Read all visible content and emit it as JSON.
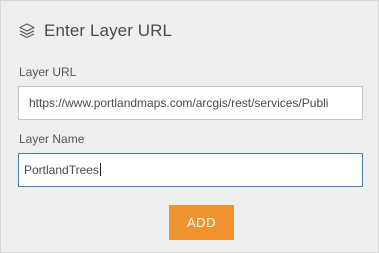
{
  "dialog": {
    "title": "Enter Layer URL",
    "title_icon": "layers-icon"
  },
  "layer_url": {
    "label": "Layer URL",
    "value": "https://www.portlandmaps.com/arcgis/rest/services/Publi"
  },
  "layer_name": {
    "label": "Layer Name",
    "value": "PortlandTrees"
  },
  "actions": {
    "add_label": "ADD"
  },
  "colors": {
    "panel_background": "#efefef",
    "accent_button": "#ef9331",
    "focused_border": "#4f7db0"
  }
}
